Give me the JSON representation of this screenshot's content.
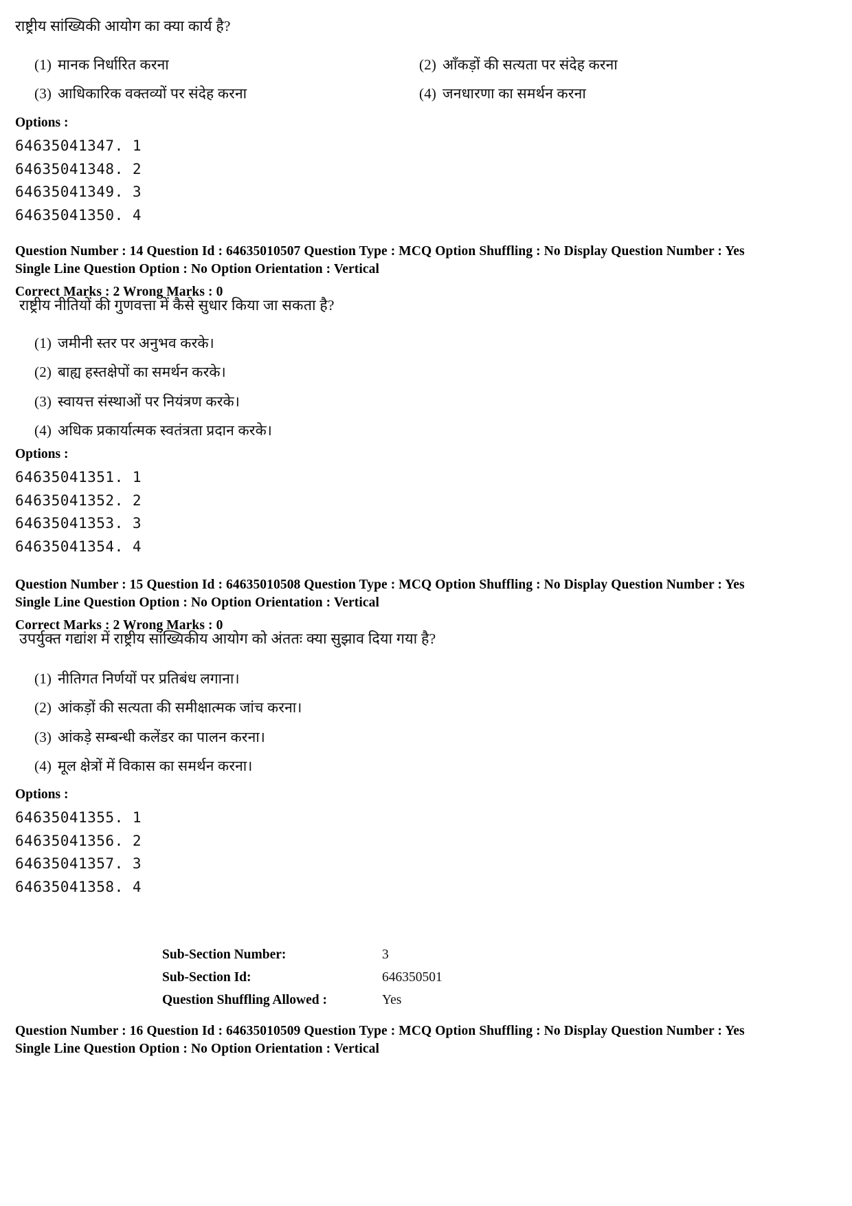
{
  "page": {
    "background": "#ffffff",
    "text_color": "#111111"
  },
  "question_13": {
    "stem": "राष्ट्रीय सांख्यिकी आयोग का क्या कार्य है?",
    "choices": [
      {
        "num": "(1)",
        "text": "मानक निर्धारित करना"
      },
      {
        "num": "(2)",
        "text": "आँकड़ों की सत्यता पर संदेह करना"
      },
      {
        "num": "(3)",
        "text": "आधिकारिक वक्तव्यों पर संदेह करना"
      },
      {
        "num": "(4)",
        "text": "जनधारणा का समर्थन करना"
      }
    ],
    "options_label": "Options :",
    "option_ids": [
      "64635041347. 1",
      "64635041348. 2",
      "64635041349. 3",
      "64635041350. 4"
    ]
  },
  "question_14": {
    "meta_line_1": "Question Number : 14  Question Id : 64635010507  Question Type : MCQ  Option Shuffling : No  Display Question Number : Yes",
    "meta_line_2": "Single Line Question Option : No  Option Orientation : Vertical",
    "meta_line_3": "Correct Marks : 2  Wrong Marks : 0",
    "stem": "राष्ट्रीय नीतियों की गुणवत्ता में कैसे सुधार किया जा सकता है?",
    "choices": [
      {
        "num": "(1)",
        "text": "जमीनी स्तर पर अनुभव करके।"
      },
      {
        "num": "(2)",
        "text": "बाह्य हस्तक्षेपों का समर्थन करके।"
      },
      {
        "num": "(3)",
        "text": "स्वायत्त संस्थाओं पर नियंत्रण करके।"
      },
      {
        "num": "(4)",
        "text": "अधिक प्रकार्यात्मक स्वतंत्रता प्रदान करके।"
      }
    ],
    "options_label": "Options :",
    "option_ids": [
      "64635041351. 1",
      "64635041352. 2",
      "64635041353. 3",
      "64635041354. 4"
    ]
  },
  "question_15": {
    "meta_line_1": "Question Number : 15  Question Id : 64635010508  Question Type : MCQ  Option Shuffling : No  Display Question Number : Yes",
    "meta_line_2": "Single Line Question Option : No  Option Orientation : Vertical",
    "meta_line_3": "Correct Marks : 2  Wrong Marks : 0",
    "stem": "उपर्युक्त गद्यांश में राष्ट्रीय सांख्यिकीय आयोग को अंततः क्या सुझाव दिया गया है?",
    "choices": [
      {
        "num": "(1)",
        "text": "नीतिगत निर्णयों पर प्रतिबंध लगाना।"
      },
      {
        "num": "(2)",
        "text": "आंकड़ों की सत्यता की समीक्षात्मक जांच करना।"
      },
      {
        "num": "(3)",
        "text": "आंकड़े सम्बन्धी कलेंडर का पालन करना।"
      },
      {
        "num": "(4)",
        "text": "मूल क्षेत्रों में विकास का समर्थन करना।"
      }
    ],
    "options_label": "Options :",
    "option_ids": [
      "64635041355. 1",
      "64635041356. 2",
      "64635041357. 3",
      "64635041358. 4"
    ]
  },
  "sub_section": {
    "rows": [
      {
        "label": "Sub-Section Number:",
        "value": "3"
      },
      {
        "label": "Sub-Section Id:",
        "value": "646350501"
      },
      {
        "label": "Question Shuffling Allowed :",
        "value": "Yes"
      }
    ]
  },
  "question_16": {
    "meta_line_1": "Question Number : 16  Question Id : 64635010509  Question Type : MCQ  Option Shuffling : No  Display Question Number : Yes",
    "meta_line_2": "Single Line Question Option : No  Option Orientation : Vertical"
  }
}
